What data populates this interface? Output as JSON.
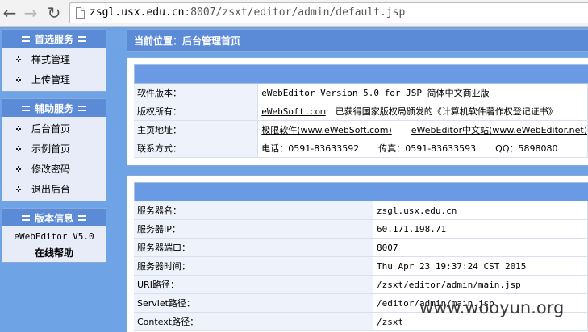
{
  "browser": {
    "url_host": "zsgl.usx.edu.cn",
    "url_path": ":8007/zsxt/editor/admin/default.jsp"
  },
  "sidebar": {
    "panels": [
      {
        "title": "首选服务",
        "items": [
          "样式管理",
          "上传管理"
        ]
      },
      {
        "title": "辅助服务",
        "items": [
          "后台首页",
          "示例首页",
          "修改密码",
          "退出后台"
        ]
      },
      {
        "title": "版本信息",
        "version": "eWebEditor V5.0",
        "help": "在线帮助"
      }
    ]
  },
  "breadcrumb": "当前位置：后台管理首页",
  "software_table": [
    {
      "key": "软件版本：",
      "value": "eWebEditor Version 5.0 for JSP 简体中文商业版"
    },
    {
      "key": "版权所有：",
      "link": "eWebSoft.com",
      "value": "已获得国家版权局颁发的《计算机软件著作权登记证书》"
    },
    {
      "key": "主页地址：",
      "link": "极限软件(www.eWebSoft.com)",
      "link2": "eWebEditor中文站(www.eWebEditor.net)"
    },
    {
      "key": "联系方式：",
      "phone": "电话：0591-83633592",
      "fax": "传真：0591-83633593",
      "qq": "QQ：5898080"
    }
  ],
  "server_table": [
    {
      "key": "服务器名：",
      "value": "zsgl.usx.edu.cn"
    },
    {
      "key": "服务器IP：",
      "value": "60.171.198.71"
    },
    {
      "key": "服务器端口：",
      "value": "8007"
    },
    {
      "key": "服务器时间：",
      "value": "Thu Apr 23 19:37:24 CST 2015"
    },
    {
      "key": "URI路径：",
      "value": "/zsxt/editor/admin/main.jsp"
    },
    {
      "key": "Servlet路径：",
      "value": "/editor/admin/main.jsp"
    },
    {
      "key": "Context路径：",
      "value": "/zsxt"
    }
  ],
  "watermark": "www.wooyun.org"
}
